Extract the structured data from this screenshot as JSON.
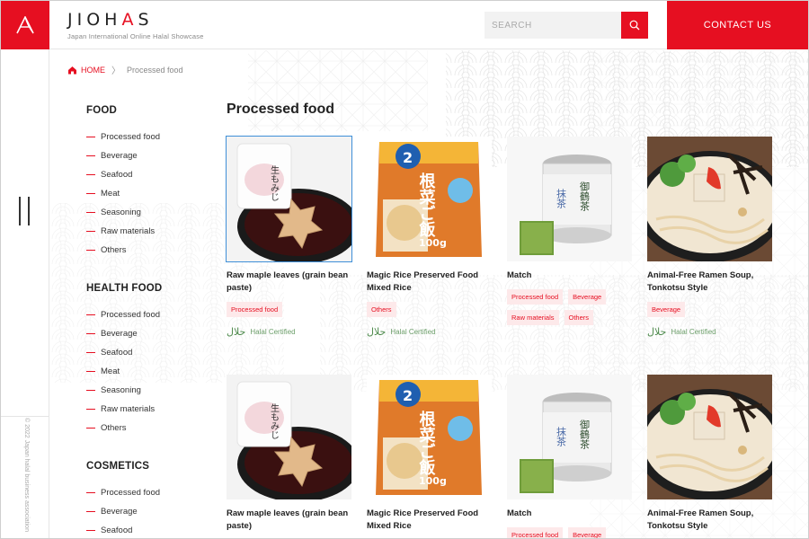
{
  "header": {
    "brand_name_part1": "JIOH",
    "brand_name_accent": "A",
    "brand_name_part2": "S",
    "brand_sub": "Japan International Online Halal Showcase",
    "search_placeholder": "SEARCH",
    "contact_label": "CONTACT US"
  },
  "leftstrip": {
    "copyright": "© 2022 Japan halal business association"
  },
  "breadcrumb": {
    "home": "HOME",
    "separator": "〉",
    "current": "Processed food"
  },
  "sidebar": {
    "groups": [
      {
        "title": "FOOD",
        "items": [
          "Processed food",
          "Beverage",
          "Seafood",
          "Meat",
          "Seasoning",
          "Raw materials",
          "Others"
        ]
      },
      {
        "title": "HEALTH FOOD",
        "items": [
          "Processed food",
          "Beverage",
          "Seafood",
          "Meat",
          "Seasoning",
          "Raw materials",
          "Others"
        ]
      },
      {
        "title": "COSMETICS",
        "items": [
          "Processed food",
          "Beverage",
          "Seafood"
        ]
      }
    ]
  },
  "main": {
    "title": "Processed food",
    "products": [
      {
        "name": "Raw maple leaves (grain bean paste)",
        "tags": [
          "Processed food"
        ],
        "halal": "Halal Certified",
        "image": "maple-sweet"
      },
      {
        "name": "Magic Rice Preserved Food Mixed Rice",
        "tags": [
          "Others"
        ],
        "halal": "Halal Certified",
        "image": "rice-pack"
      },
      {
        "name": "Match",
        "tags": [
          "Processed food",
          "Beverage",
          "Raw materials",
          "Others"
        ],
        "halal": "",
        "image": "matcha-can"
      },
      {
        "name": "Animal-Free Ramen Soup, Tonkotsu Style",
        "tags": [
          "Beverage"
        ],
        "halal": "Halal Certified",
        "image": "ramen-bowl"
      },
      {
        "name": "Raw maple leaves (grain bean paste)",
        "tags": [],
        "halal": "",
        "image": "maple-sweet"
      },
      {
        "name": "Magic Rice Preserved Food Mixed Rice",
        "tags": [],
        "halal": "",
        "image": "rice-pack"
      },
      {
        "name": "Match",
        "tags": [
          "Processed food",
          "Beverage"
        ],
        "halal": "",
        "image": "matcha-can"
      },
      {
        "name": "Animal-Free Ramen Soup, Tonkotsu Style",
        "tags": [],
        "halal": "",
        "image": "ramen-bowl"
      }
    ],
    "halal_mark": "حلال",
    "package_text": {
      "rice_badge": "2",
      "rice_title": "根菜ご飯",
      "rice_weight": "100g",
      "matcha_label": "抹茶",
      "matcha_brand": "御鶴茶",
      "sweet_label": "生もみじ"
    }
  },
  "colors": {
    "accent": "#e60f21",
    "tag_bg": "#fde9ea",
    "halal_green": "#4e8a4c",
    "active_outline": "#3f8fd8"
  },
  "icons": [
    "jiohas-logo-icon",
    "search-icon",
    "home-icon",
    "menu-icon",
    "halal-icon"
  ]
}
